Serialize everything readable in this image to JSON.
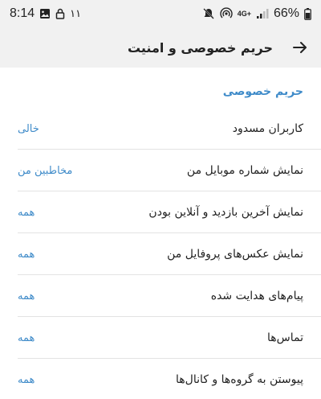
{
  "status_bar": {
    "time": "8:14",
    "notif_count": "۱۱",
    "network": "4G+",
    "battery": "66%"
  },
  "header": {
    "title": "حریم خصوصی و امنیت"
  },
  "section": {
    "title": "حریم خصوصی"
  },
  "rows": [
    {
      "label": "کاربران مسدود",
      "value": "خالی"
    },
    {
      "label": "نمایش شماره موبایل من",
      "value": "مخاطبین من"
    },
    {
      "label": "نمایش آخرین بازدید و آنلاین بودن",
      "value": "همه"
    },
    {
      "label": "نمایش عکس‌های پروفایل من",
      "value": "همه"
    },
    {
      "label": "پیام‌های هدایت شده",
      "value": "همه"
    },
    {
      "label": "تماس‌ها",
      "value": "همه"
    },
    {
      "label": "پیوستن به گروه‌ها و کانال‌ها",
      "value": "همه"
    }
  ],
  "colors": {
    "accent": "#3f8bc9",
    "bar_bg": "#f1f1f1"
  }
}
